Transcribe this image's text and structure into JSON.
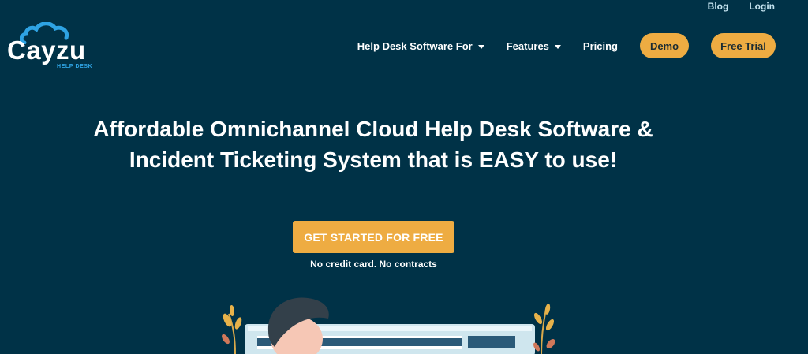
{
  "utility_nav": {
    "blog": "Blog",
    "login": "Login"
  },
  "logo": {
    "wordmark": "Cayzu",
    "sub": "HELP DESK"
  },
  "nav": {
    "help_desk": "Help Desk Software For",
    "features": "Features",
    "pricing": "Pricing",
    "demo": "Demo",
    "free_trial": "Free Trial"
  },
  "hero": {
    "title_line1": "Affordable Omnichannel Cloud Help Desk Software &",
    "title_line2": "Incident Ticketing System that is EASY to use!",
    "cta": "GET STARTED FOR FREE",
    "cta_note": "No credit card. No contracts"
  },
  "colors": {
    "background": "#003247",
    "accent": "#eeac42",
    "logo_blue": "#2ea3e3"
  },
  "icons": {
    "logo": "cloud-logo-icon",
    "dropdown": "chevron-down-icon",
    "illustration": "support-agent-illustration"
  }
}
